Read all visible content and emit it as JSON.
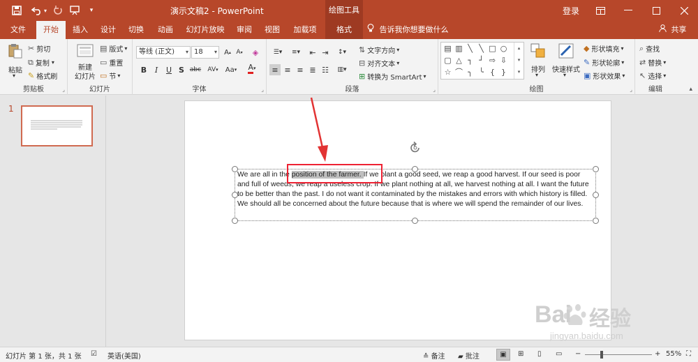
{
  "titlebar": {
    "doc_title": "演示文稿2  -  PowerPoint",
    "context_tools": "绘图工具",
    "login": "登录",
    "save_icon": "save-icon",
    "undo_icon": "undo-icon",
    "redo_icon": "redo-icon",
    "present_icon": "present-icon",
    "customize_icon": "customize-qat-icon",
    "ribbon_display_icon": "ribbon-display-icon"
  },
  "tabs": [
    {
      "label": "文件"
    },
    {
      "label": "开始"
    },
    {
      "label": "插入"
    },
    {
      "label": "设计"
    },
    {
      "label": "切换"
    },
    {
      "label": "动画"
    },
    {
      "label": "幻灯片放映"
    },
    {
      "label": "审阅"
    },
    {
      "label": "视图"
    },
    {
      "label": "加载项"
    },
    {
      "label": "格式"
    }
  ],
  "tellme": "告诉我你想要做什么",
  "share": "共享",
  "ribbon": {
    "clipboard": {
      "label": "剪贴板",
      "paste": "粘贴",
      "cut": "剪切",
      "copy": "复制",
      "format_painter": "格式刷"
    },
    "slides": {
      "label": "幻灯片",
      "new_slide_line1": "新建",
      "new_slide_line2": "幻灯片",
      "layout": "版式",
      "reset": "重置",
      "section": "节"
    },
    "font": {
      "label": "字体",
      "font_name": "等线 (正文)",
      "font_size": "18",
      "bold": "B",
      "italic": "I",
      "underline": "U",
      "shadow": "S",
      "strike": "abc",
      "spacing": "AV",
      "case": "Aa",
      "color": "A"
    },
    "paragraph": {
      "label": "段落",
      "text_direction": "文字方向",
      "align_text": "对齐文本",
      "smartart": "转换为 SmartArt"
    },
    "drawing": {
      "label": "绘图",
      "arrange": "排列",
      "quick_styles": "快速样式",
      "shape_fill": "形状填充",
      "shape_outline": "形状轮廓",
      "shape_effects": "形状效果"
    },
    "editing": {
      "label": "编辑",
      "find": "查找",
      "replace": "替换",
      "select": "选择"
    }
  },
  "thumbnail": {
    "number": "1"
  },
  "slide": {
    "text_before": "We are all in the ",
    "text_highlight": "position of the farmer. ",
    "text_after": " If we plant a good seed, we reap a good harvest. If our seed is poor and full of weeds, we reap a useless crop. If we plant nothing at all, we harvest nothing at all. I want the future to be better than the past. I do not want it contaminated by the mistakes and errors with which history is filled. We should all be concerned about the future because that is where we will spend the remainder of our lives."
  },
  "status": {
    "slide_info": "幻灯片 第 1 张，共 1 张",
    "language": "英语(美国)",
    "notes": "备注",
    "comments": "批注",
    "zoom": "55%",
    "zoom_level": 55
  },
  "watermark": {
    "brand": "Bai",
    "brand2": "经验",
    "url": "jingyan.baidu.com"
  },
  "colors": {
    "accent": "#b7472a",
    "highlight": "#bfbfbf",
    "callout": "#e23333"
  }
}
